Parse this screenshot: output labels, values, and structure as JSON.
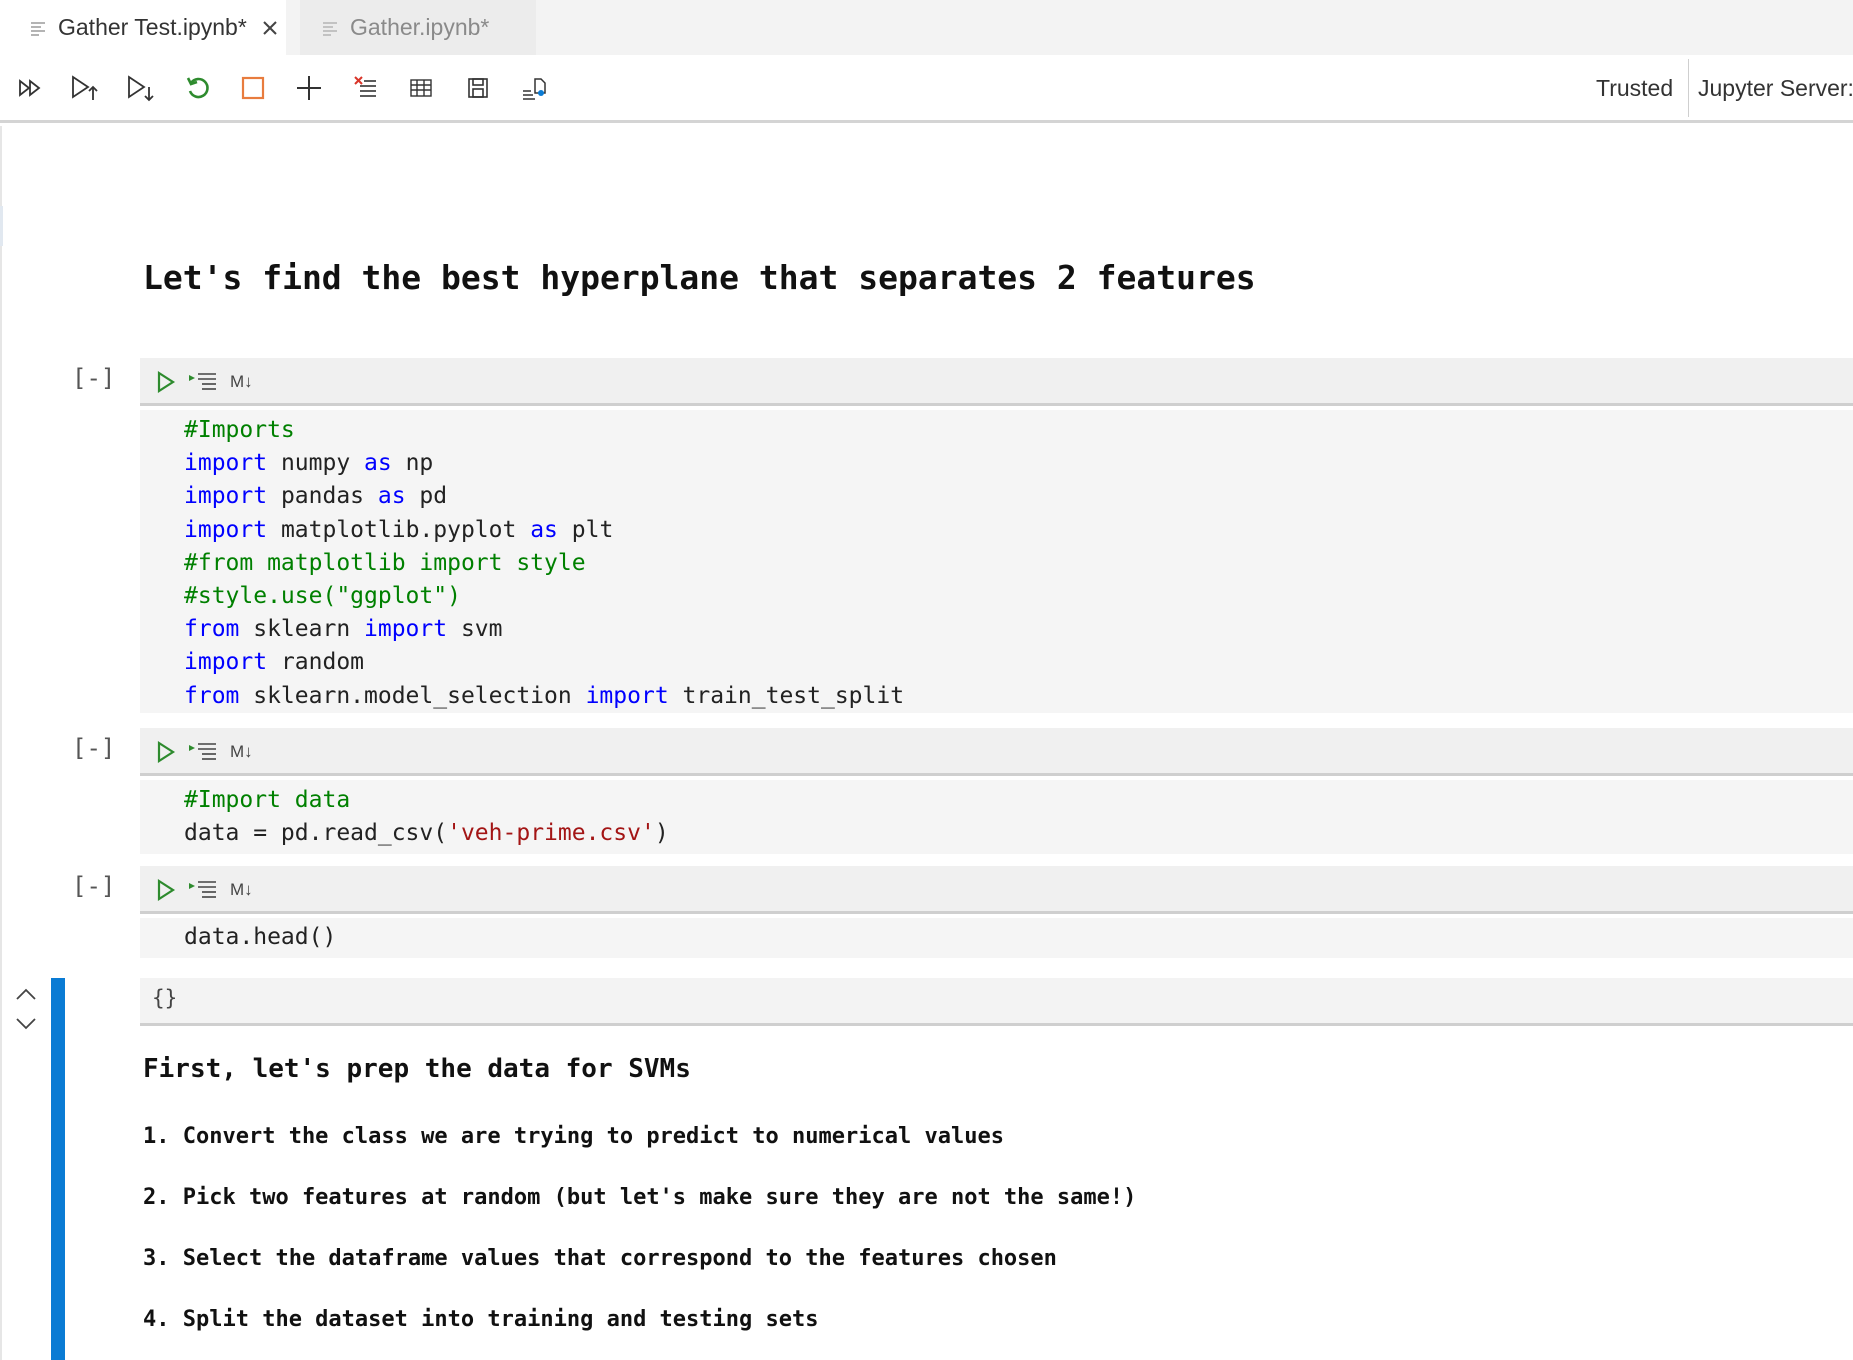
{
  "tabs": [
    {
      "label": "Gather Test.ipynb*",
      "active": true
    },
    {
      "label": "Gather.ipynb*",
      "active": false
    }
  ],
  "toolbar": {
    "buttons": [
      {
        "icon": "run-all-icon"
      },
      {
        "icon": "run-above-icon"
      },
      {
        "icon": "run-below-icon"
      },
      {
        "icon": "restart-kernel-icon"
      },
      {
        "icon": "interrupt-kernel-icon"
      },
      {
        "icon": "add-cell-icon"
      },
      {
        "icon": "clear-outputs-icon"
      },
      {
        "icon": "variable-explorer-icon"
      },
      {
        "icon": "save-icon"
      },
      {
        "icon": "export-icon"
      }
    ],
    "trusted_label": "Trusted",
    "server_label": "Jupyter Server: l"
  },
  "notebook": {
    "heading": "Let's find the best hyperplane that separates 2 features",
    "cells": [
      {
        "exec_count": "[-]",
        "md_toggle": "M↓",
        "lines": [
          [
            {
              "t": "#Imports",
              "c": "cm"
            }
          ],
          [
            {
              "t": "import",
              "c": "kw"
            },
            {
              "t": " numpy ",
              "c": ""
            },
            {
              "t": "as",
              "c": "kw"
            },
            {
              "t": " np",
              "c": ""
            }
          ],
          [
            {
              "t": "import",
              "c": "kw"
            },
            {
              "t": " pandas ",
              "c": ""
            },
            {
              "t": "as",
              "c": "kw"
            },
            {
              "t": " pd",
              "c": ""
            }
          ],
          [
            {
              "t": "import",
              "c": "kw"
            },
            {
              "t": " matplotlib.pyplot ",
              "c": ""
            },
            {
              "t": "as",
              "c": "kw"
            },
            {
              "t": " plt",
              "c": ""
            }
          ],
          [
            {
              "t": "#from matplotlib import style",
              "c": "cm"
            }
          ],
          [
            {
              "t": "#style.use(\"ggplot\")",
              "c": "cm"
            }
          ],
          [
            {
              "t": "from",
              "c": "kw"
            },
            {
              "t": " sklearn ",
              "c": ""
            },
            {
              "t": "import",
              "c": "kw"
            },
            {
              "t": " svm",
              "c": ""
            }
          ],
          [
            {
              "t": "import",
              "c": "kw"
            },
            {
              "t": " random",
              "c": ""
            }
          ],
          [
            {
              "t": "from",
              "c": "kw"
            },
            {
              "t": " sklearn.model_selection ",
              "c": ""
            },
            {
              "t": "import",
              "c": "kw"
            },
            {
              "t": " train_test_split",
              "c": ""
            }
          ]
        ]
      },
      {
        "exec_count": "[-]",
        "md_toggle": "M↓",
        "lines": [
          [
            {
              "t": "#Import data",
              "c": "cm"
            }
          ],
          [
            {
              "t": "data = pd.read_csv(",
              "c": ""
            },
            {
              "t": "'veh-prime.csv'",
              "c": "str"
            },
            {
              "t": ")",
              "c": ""
            }
          ]
        ]
      },
      {
        "exec_count": "[-]",
        "md_toggle": "M↓",
        "lines": [
          [
            {
              "t": "data.head()",
              "c": ""
            }
          ]
        ]
      }
    ],
    "output": {
      "braces": "{}",
      "subheading": "First, let's prep the data for SVMs",
      "items": [
        "1. Convert the class we are trying to predict to numerical values",
        "2. Pick two features at random (but let's make sure they are not the same!)",
        "3. Select the dataframe values that correspond to the features chosen",
        "4. Split the dataset into training and testing sets"
      ]
    }
  },
  "colors": {
    "keyword": "#0000ff",
    "comment": "#008000",
    "string": "#a31515",
    "run_green": "#2e8b2e",
    "restart_green": "#2e8b2e",
    "interrupt_orange": "#e87c3e",
    "selection_bar": "#0a7bd4"
  }
}
